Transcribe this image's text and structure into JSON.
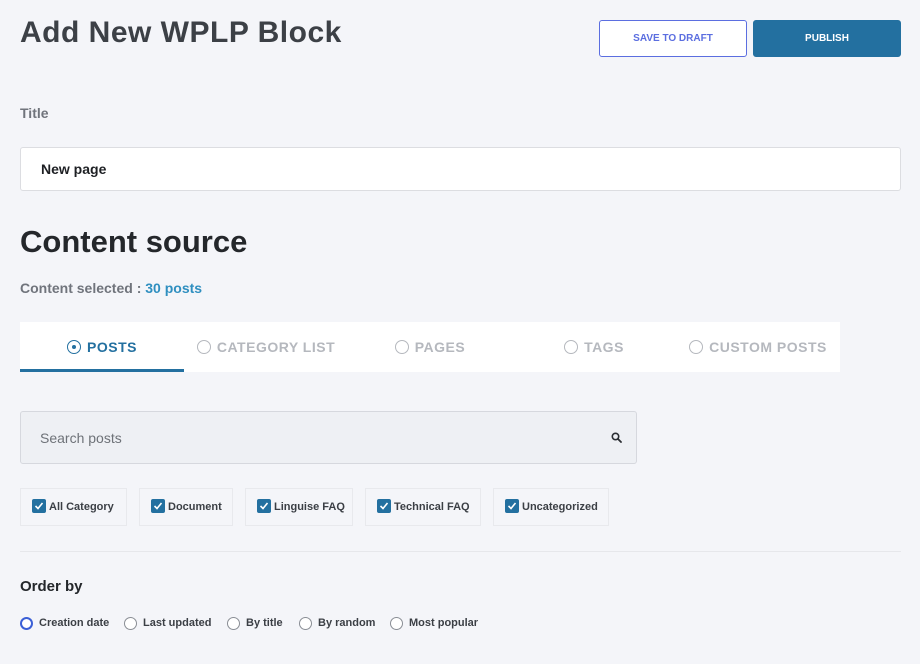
{
  "header": {
    "title": "Add New WPLP Block",
    "save_draft_label": "SAVE TO DRAFT",
    "publish_label": "PUBLISH"
  },
  "title_field": {
    "label": "Title",
    "value": "New page"
  },
  "content_source": {
    "heading": "Content source",
    "selected_label": "Content selected :",
    "selected_count": "30 posts"
  },
  "tabs": [
    {
      "label": "POSTS",
      "active": true
    },
    {
      "label": "CATEGORY LIST",
      "active": false
    },
    {
      "label": "PAGES",
      "active": false
    },
    {
      "label": "TAGS",
      "active": false
    },
    {
      "label": "CUSTOM POSTS",
      "active": false
    }
  ],
  "search": {
    "placeholder": "Search posts",
    "icon": "search-icon"
  },
  "categories": [
    {
      "label": "All Category",
      "checked": true
    },
    {
      "label": "Document",
      "checked": true
    },
    {
      "label": "Linguise FAQ",
      "checked": true
    },
    {
      "label": "Technical FAQ",
      "checked": true
    },
    {
      "label": "Uncategorized",
      "checked": true
    }
  ],
  "order_by": {
    "heading": "Order by",
    "options": [
      {
        "label": "Creation date",
        "selected": true
      },
      {
        "label": "Last updated",
        "selected": false
      },
      {
        "label": "By title",
        "selected": false
      },
      {
        "label": "By random",
        "selected": false
      },
      {
        "label": "Most popular",
        "selected": false
      }
    ]
  },
  "colors": {
    "accent": "#2370a0",
    "draft_border": "#5b6ee0",
    "count_link": "#2f8fc0",
    "background": "#f4f5f9"
  }
}
